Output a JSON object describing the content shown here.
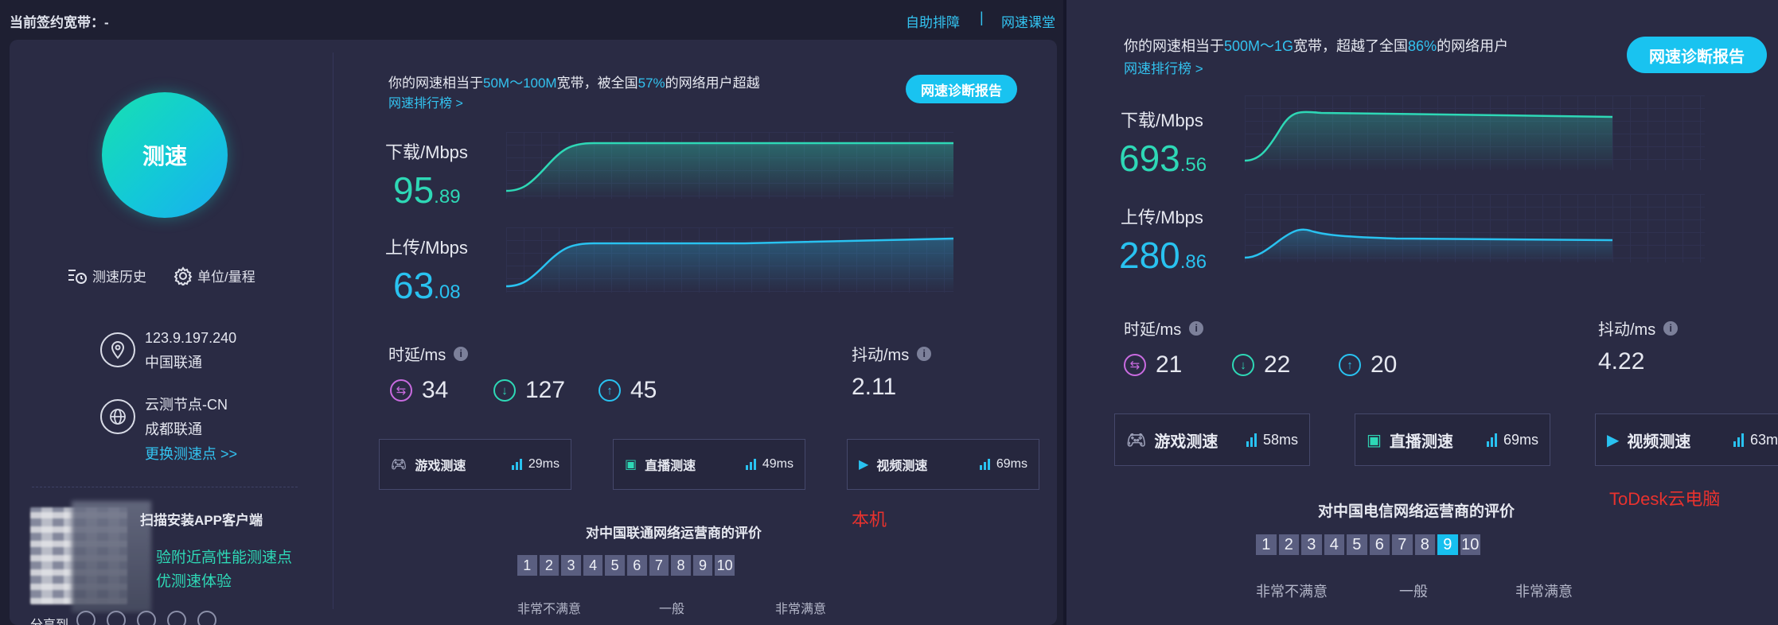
{
  "left": {
    "top_bar": {
      "plan_label": "当前签约宽带：-",
      "link_self_help": "自助排障",
      "separator": "|",
      "link_class": "网速课堂"
    },
    "speed_button": "测速",
    "history_label": "测速历史",
    "unit_label": "单位/量程",
    "ip": "123.9.197.240",
    "isp": "中国联通",
    "node_name": "云测节点-CN",
    "node_isp": "成都联通",
    "change_node": "更换测速点 >>",
    "app_title": "扫描安装APP客户端",
    "app_line1": "验附近高性能测速点",
    "app_line2": "优测速体验",
    "share_label": "分享到",
    "summary_pre": "你的网速相当于",
    "summary_speed": "50M～100M",
    "summary_mid": "宽带，被全国",
    "summary_pct": "57%",
    "summary_post": "的网络用户超越",
    "rank_link": "网速排行榜 >",
    "report_button": "网速诊断报告",
    "download_label": "下载/Mbps",
    "download_int": "95",
    "download_dec": ".89",
    "upload_label": "上传/Mbps",
    "upload_int": "63",
    "upload_dec": ".08",
    "latency_label": "时延/ms",
    "latency_values": [
      "34",
      "127",
      "45"
    ],
    "jitter_label": "抖动/ms",
    "jitter_value": "2.11",
    "tests": [
      {
        "name": "游戏测速",
        "ms": "29ms"
      },
      {
        "name": "直播测速",
        "ms": "49ms"
      },
      {
        "name": "视频测速",
        "ms": "69ms"
      }
    ],
    "rating_title": "对中国联通网络运营商的评价",
    "rating_scale": [
      "1",
      "2",
      "3",
      "4",
      "5",
      "6",
      "7",
      "8",
      "9",
      "10"
    ],
    "rating_low": "非常不满意",
    "rating_mid": "一般",
    "rating_high": "非常满意",
    "note": "本机"
  },
  "right": {
    "summary_pre": "你的网速相当于",
    "summary_speed": "500M～1G",
    "summary_mid": "宽带，超越了全国",
    "summary_pct": "86%",
    "summary_post": "的网络用户",
    "rank_link": "网速排行榜 >",
    "report_button": "网速诊断报告",
    "download_label": "下载/Mbps",
    "download_int": "693",
    "download_dec": ".56",
    "upload_label": "上传/Mbps",
    "upload_int": "280",
    "upload_dec": ".86",
    "latency_label": "时延/ms",
    "latency_values": [
      "21",
      "22",
      "20"
    ],
    "jitter_label": "抖动/ms",
    "jitter_value": "4.22",
    "tests": [
      {
        "name": "游戏测速",
        "ms": "58ms"
      },
      {
        "name": "直播测速",
        "ms": "69ms"
      },
      {
        "name": "视频测速",
        "ms": "63m"
      }
    ],
    "rating_title": "对中国电信网络运营商的评价",
    "rating_scale": [
      "1",
      "2",
      "3",
      "4",
      "5",
      "6",
      "7",
      "8",
      "9",
      "10"
    ],
    "rating_selected": "9",
    "rating_low": "非常不满意",
    "rating_mid": "一般",
    "rating_high": "非常满意",
    "note": "ToDesk云电脑"
  },
  "colors": {
    "download": "#2ed8b6",
    "upload": "#29c2f0",
    "accent": "#19c3f0",
    "note": "#e8322e"
  }
}
